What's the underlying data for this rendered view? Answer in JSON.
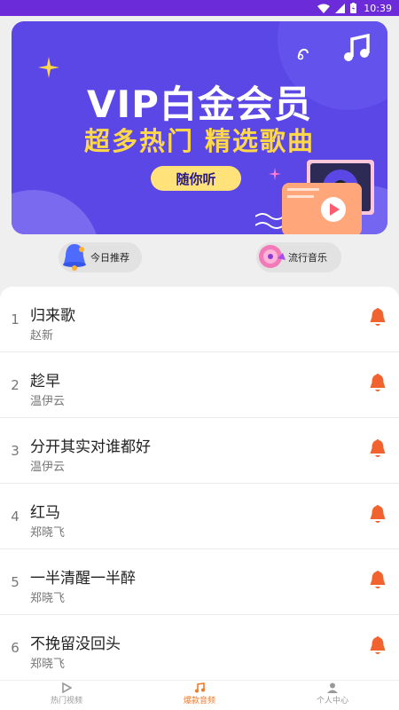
{
  "status_bar": {
    "time": "10:39"
  },
  "banner": {
    "title": "VIP白金会员",
    "subtitle": "超多热门  精选歌曲",
    "button_label": "随你听"
  },
  "quick_actions": [
    {
      "label": "今日推荐",
      "icon": "bell-3d-icon"
    },
    {
      "label": "流行音乐",
      "icon": "vinyl-disc-icon"
    }
  ],
  "songs": [
    {
      "num": "1",
      "title": "归来歌",
      "artist": "赵新"
    },
    {
      "num": "2",
      "title": "趁早",
      "artist": "温伊云"
    },
    {
      "num": "3",
      "title": "分开其实对谁都好",
      "artist": "温伊云"
    },
    {
      "num": "4",
      "title": "红马",
      "artist": "郑晓飞"
    },
    {
      "num": "5",
      "title": "一半清醒一半醉",
      "artist": "郑晓飞"
    },
    {
      "num": "6",
      "title": "不挽留没回头",
      "artist": "郑晓飞"
    }
  ],
  "tabbar": {
    "items": [
      {
        "label": "热门视频",
        "icon": "play-icon"
      },
      {
        "label": "爆款音频",
        "icon": "music-note-icon",
        "active": true
      },
      {
        "label": "个人中心",
        "icon": "user-icon"
      }
    ]
  },
  "colors": {
    "status_bar": "#6c2bd9",
    "banner_bg": "#5b46e6",
    "accent_orange": "#f2622e",
    "subtitle_yellow": "#ffd84a"
  }
}
